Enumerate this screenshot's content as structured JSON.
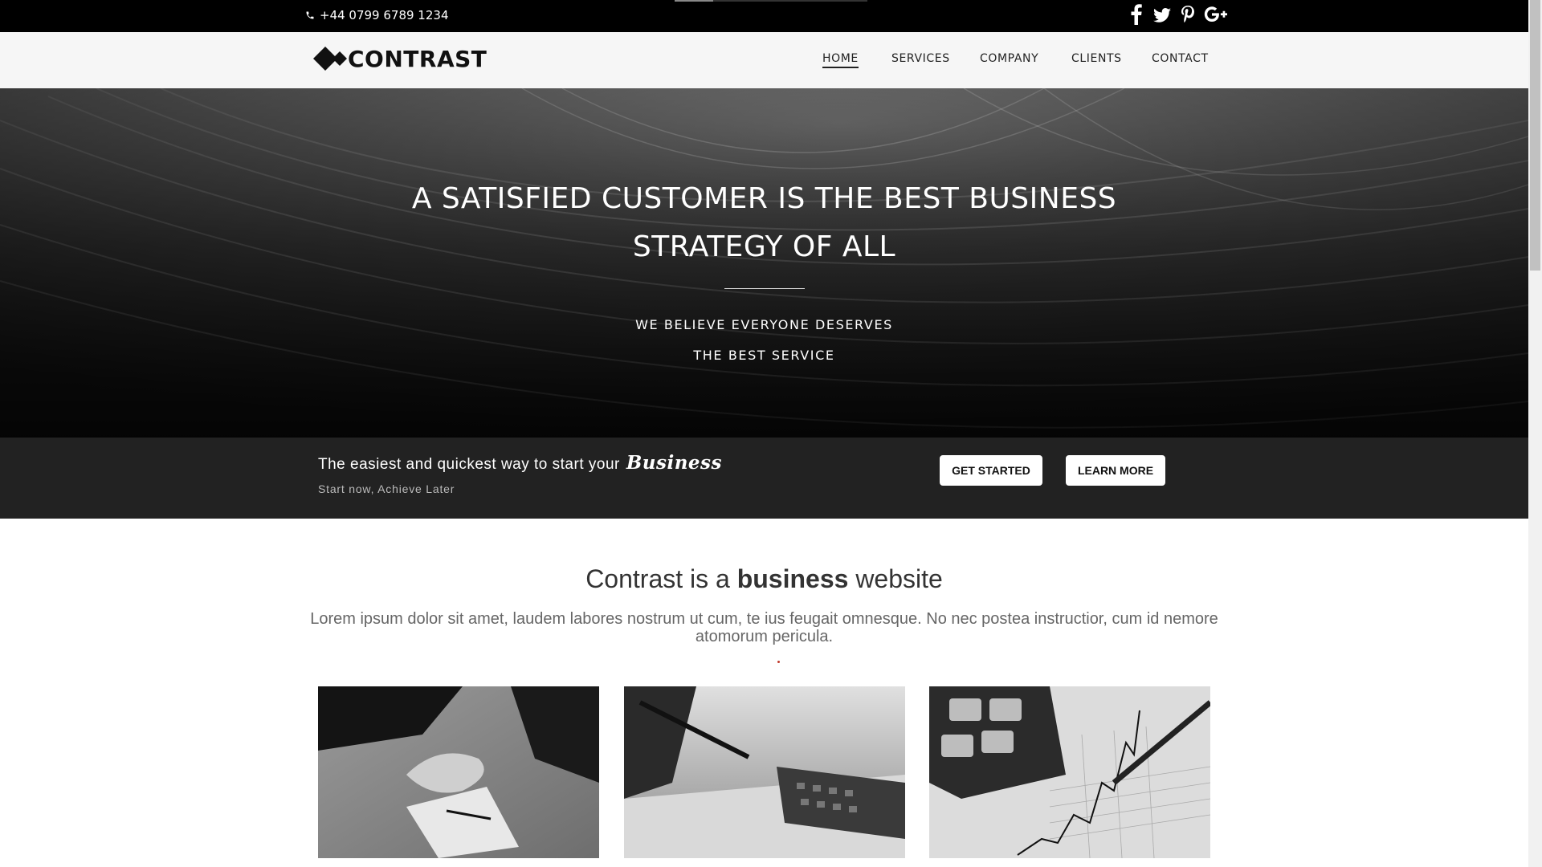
{
  "topbar": {
    "phone": "+44 0799 6789 1234",
    "social": [
      "facebook-icon",
      "twitter-icon",
      "pinterest-icon",
      "google-plus-icon"
    ]
  },
  "header": {
    "logo": "CONTRAST",
    "nav": [
      "HOME",
      "SERVICES",
      "COMPANY",
      "CLIENTS",
      "CONTACT"
    ],
    "active": "HOME"
  },
  "hero": {
    "title_line1": "A SATISFIED CUSTOMER IS THE BEST BUSINESS",
    "title_line2": "STRATEGY OF ALL",
    "subtitle_line1": "WE BELIEVE EVERYONE DESERVES",
    "subtitle_line2": "THE BEST SERVICE"
  },
  "cta": {
    "text": "The easiest and quickest way to start your",
    "emphasis": "Business",
    "subtext": "Start now, Achieve Later",
    "get_started": "GET STARTED",
    "learn_more": "LEARN MORE"
  },
  "intro": {
    "title_prefix": "Contrast is a",
    "title_bold": "business",
    "title_suffix": "website",
    "text": "Lorem ipsum dolor sit amet, laudem labores nostrum ut cum, te ius feugait omnesque. No nec postea instructior, cum id nemore atomorum pericula."
  },
  "colors": {
    "topbar": "#000000",
    "header": "#f6f6f6",
    "cta_band": "#222222",
    "accent_dot": "#c0392b"
  }
}
